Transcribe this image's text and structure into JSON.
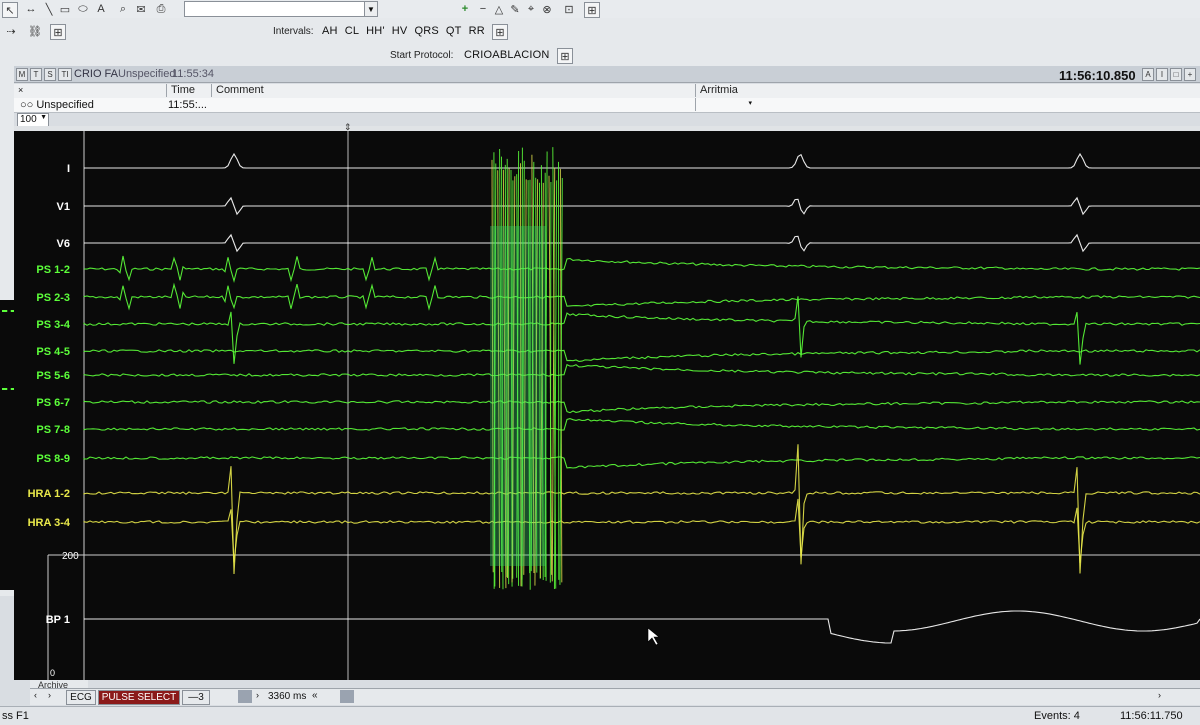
{
  "toolbar_top": {
    "dropdown_value": ""
  },
  "intervals": {
    "label": "Intervals:",
    "items": [
      "AH",
      "CL",
      "HH'",
      "HV",
      "QRS",
      "QT",
      "RR"
    ]
  },
  "protocol": {
    "label": "Start Protocol:",
    "value": "CRIOABLACION"
  },
  "panel_header": {
    "tabs": [
      "M",
      "T",
      "S",
      "TI"
    ],
    "title": "CRIO FA",
    "status": "Unspecified",
    "time": "11:55:34",
    "clock": "11:56:10.850"
  },
  "event_table": {
    "headers": [
      "Time",
      "Comment",
      "Arritmia"
    ],
    "row": {
      "name": "Unspecified",
      "time": "11:55:..."
    },
    "zoom": "100"
  },
  "channels": [
    {
      "label": "I",
      "color": "#ffffff"
    },
    {
      "label": "V1",
      "color": "#ffffff"
    },
    {
      "label": "V6",
      "color": "#ffffff"
    },
    {
      "label": "PS 1-2",
      "color": "#5cff3a"
    },
    {
      "label": "PS 2-3",
      "color": "#5cff3a"
    },
    {
      "label": "PS 3-4",
      "color": "#5cff3a"
    },
    {
      "label": "PS 4-5",
      "color": "#5cff3a"
    },
    {
      "label": "PS 5-6",
      "color": "#5cff3a"
    },
    {
      "label": "PS 6-7",
      "color": "#5cff3a"
    },
    {
      "label": "PS 7-8",
      "color": "#5cff3a"
    },
    {
      "label": "PS 8-9",
      "color": "#5cff3a"
    },
    {
      "label": "HRA 1-2",
      "color": "#e8e84a"
    },
    {
      "label": "HRA 3-4",
      "color": "#e8e84a"
    },
    {
      "label": "BP 1",
      "color": "#ffffff"
    }
  ],
  "bp_scale": {
    "top": "200",
    "bottom": "0"
  },
  "bottom_bar": {
    "archive": "Archive",
    "tab_ecg": "ECG",
    "tab_pulse": "PULSE SELECT",
    "tab_3": "3",
    "sweep": "3360 ms"
  },
  "status_bar": {
    "left": "ss F1",
    "events": "Events: 4",
    "time": "11:56:11.750"
  },
  "colors": {
    "screen_bg": "#0a0a0a",
    "ecg": "#ffffff",
    "ps": "#5cff3a",
    "hra": "#e8e84a",
    "pulse_tab": "#8b1a1a"
  }
}
